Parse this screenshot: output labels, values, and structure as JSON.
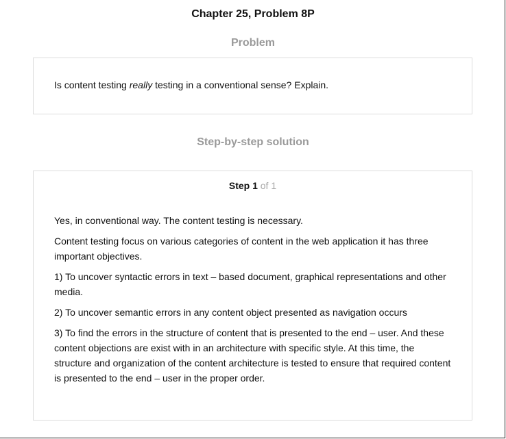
{
  "header": {
    "chapter_title": "Chapter 25, Problem 8P"
  },
  "problem": {
    "heading": "Problem",
    "text_before": "Is content testing ",
    "text_emphasis": "really",
    "text_after": " testing in a conventional sense? Explain."
  },
  "solution": {
    "heading": "Step-by-step solution",
    "step_word": "Step 1",
    "step_of": " of 1",
    "paragraphs": [
      "Yes, in conventional way. The content testing is necessary.",
      "Content testing focus on various categories of content in the web application it has three important objectives.",
      "1) To uncover syntactic errors in text – based document, graphical representations and other media.",
      "2) To uncover semantic errors in any content object presented as navigation occurs",
      "3) To find the errors in the structure of content that is presented to the end – user. And these content objections are exist with in an architecture with specific style. At this time, the structure and organization of the content architecture is tested to ensure that required content is presented to the end – user in the proper order."
    ]
  }
}
